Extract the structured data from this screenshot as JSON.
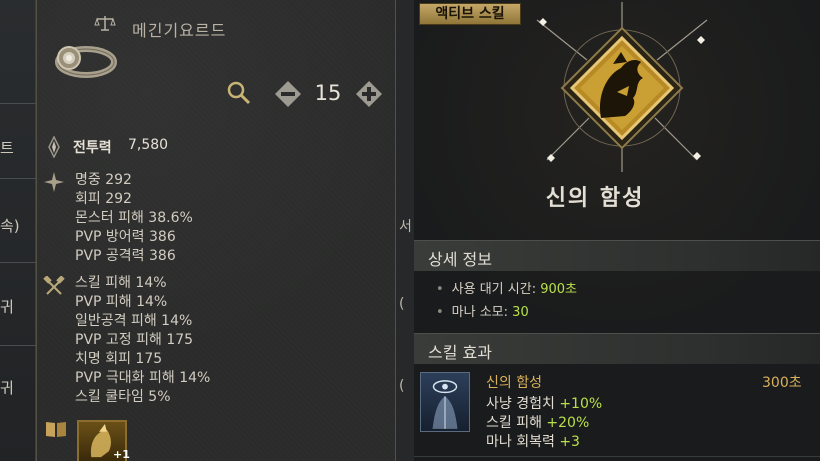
{
  "left_edge": {
    "fragments": [
      "트",
      "속)",
      "귀",
      "귀"
    ]
  },
  "mid_edge": {
    "fragments": [
      "서",
      "(",
      "("
    ]
  },
  "item": {
    "name": "메긴기요르드",
    "level": "15",
    "combat_power_label": "전투력",
    "combat_power_value": "7,580",
    "stats_group1": [
      "명중  292",
      "회피  292",
      "몬스터 피해  38.6%",
      "PVP 방어력  386",
      "PVP 공격력  386"
    ],
    "stats_group2": [
      "스킬 피해  14%",
      "PVP 피해  14%",
      "일반공격 피해  14%",
      "PVP 고정 피해  175",
      "치명 회피  175",
      "PVP 극대화 피해  14%",
      "스킬 쿨타임  5%"
    ],
    "skill_thumb_badge": "+1"
  },
  "skill": {
    "tag": "액티브 스킬",
    "name": "신의 함성",
    "detail_title": "상세 정보",
    "cooldown_label": "사용 대기 시간: ",
    "cooldown_value": "900초",
    "mana_label": "마나 소모: ",
    "mana_value": "30",
    "effect_title": "스킬 효과",
    "effect_name": "신의 함성",
    "effect_duration": "300초",
    "effects": [
      {
        "label": "사냥 경험치 ",
        "value": "+10%"
      },
      {
        "label": "스킬 피해 ",
        "value": "+20%"
      },
      {
        "label": "마나 회복력 ",
        "value": "+3"
      }
    ]
  },
  "colors": {
    "gold": "#d9b25b",
    "bonus_green": "#b8e04a",
    "tag_gold": "#c5a768"
  },
  "icons": [
    "ring-icon",
    "scale-icon",
    "magnifier-icon",
    "minus-icon",
    "plus-icon",
    "combat-power-icon",
    "star-icon",
    "crossed-hammers-icon",
    "book-icon",
    "skill-emblem-icon",
    "effect-eye-icon"
  ]
}
